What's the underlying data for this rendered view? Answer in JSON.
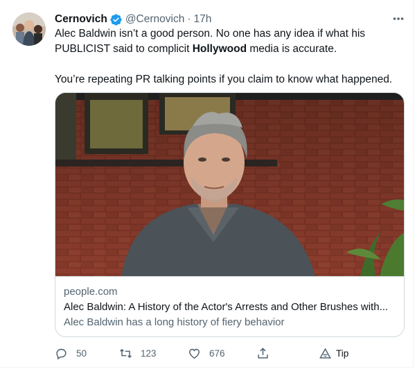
{
  "tweet": {
    "author_name": "Cernovich",
    "handle": "@Cernovich",
    "separator": "·",
    "time": "17h",
    "text_line1": "Alec Baldwin isn’t a good person. No one has any idea if what his",
    "text_line2_a": "PUBLICIST said to complicit ",
    "text_line2_bold": "Hollywood",
    "text_line2_b": " media is accurate.",
    "text_line3": "You’re repeating PR talking points if you claim to know what happened."
  },
  "card": {
    "domain": "people.com",
    "title": "Alec Baldwin: A History of the Actor's Arrests and Other Brushes with...",
    "description": "Alec Baldwin has a long history of fiery behavior"
  },
  "actions": {
    "replies": "50",
    "retweets": "123",
    "likes": "676",
    "tip": "Tip"
  },
  "icons": {
    "verified": "verified-badge-icon",
    "more": "more-icon",
    "reply": "reply-icon",
    "retweet": "retweet-icon",
    "like": "heart-icon",
    "share": "share-icon",
    "tip": "tip-icon"
  },
  "colors": {
    "verified": "#1d9bf0",
    "secondary_text": "#536471",
    "primary_text": "#0f1419",
    "border": "#cfd9de"
  }
}
